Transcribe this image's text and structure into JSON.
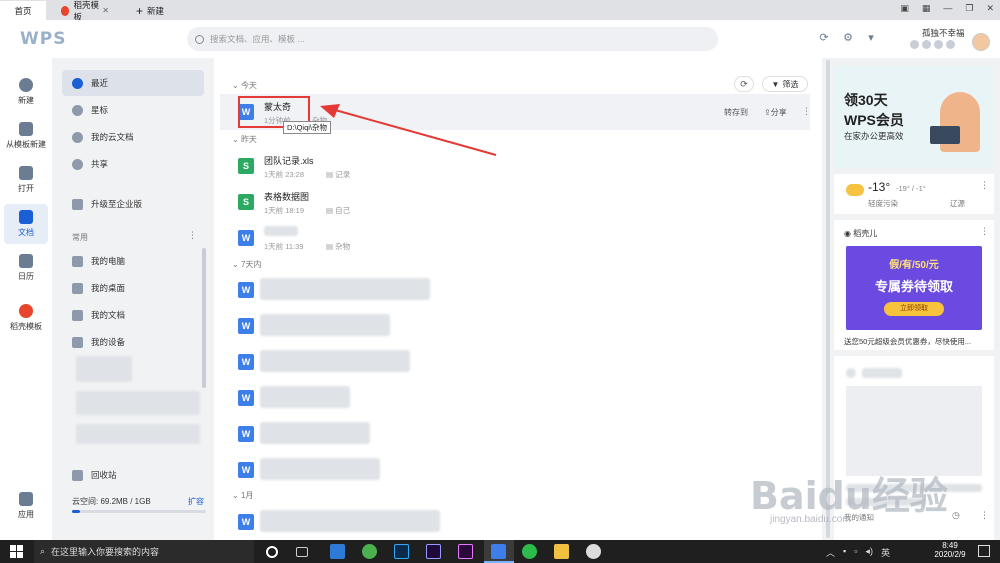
{
  "tabs": {
    "home": "首页",
    "template": "稻壳模板",
    "new": "新建"
  },
  "search": {
    "placeholder": "搜索文档、应用、模板 ..."
  },
  "user": {
    "name": "孤独不幸福"
  },
  "rail": {
    "new": "新建",
    "from_template": "从模板新建",
    "open": "打开",
    "docs": "文档",
    "calendar": "日历",
    "daoke": "稻壳模板",
    "apps": "应用"
  },
  "nav": {
    "recent": "最近",
    "star": "星标",
    "cloud": "我的云文档",
    "share": "共享",
    "upgrade": "升级至企业版",
    "frequent": "常用",
    "computer": "我的电脑",
    "desktop": "我的桌面",
    "documents": "我的文档",
    "devices": "我的设备",
    "recycle": "回收站",
    "cloud_space": "云空间: 69.2MB / 1GB",
    "expand": "扩容"
  },
  "main": {
    "filter": "筛选",
    "sections": {
      "today": "今天",
      "yesterday": "昨天",
      "week": "7天内",
      "jan": "1月"
    },
    "files": [
      {
        "name": "蒙太奇",
        "time": "1分钟前",
        "loc": "杂物",
        "actions_move": "转存到",
        "actions_share": "分享"
      },
      {
        "name": "团队记录.xls",
        "time": "1天前 23:28",
        "loc": "记录"
      },
      {
        "name": "表格数据图",
        "time": "1天前 18:19",
        "loc": "自己"
      },
      {
        "name": "",
        "time": "1天前 11:39",
        "loc": "杂物"
      }
    ],
    "tooltip": "D:\\Qiqi\\杂物"
  },
  "right": {
    "ad_title1": "领30天",
    "ad_title2": "WPS会员",
    "ad_sub": "在家办公更高效",
    "weather_temp": "-13°",
    "weather_range": "-19° / -1°",
    "weather_aq": "轻度污染",
    "weather_city": "辽源",
    "daoke_title": "稻壳儿",
    "coupon": "假/有/50/元",
    "coupon_title": "专属券待领取",
    "coupon_btn": "立即领取",
    "coupon_desc": "送您50元超级会员优惠券，尽快使用...",
    "notice": "我的通知"
  },
  "taskbar": {
    "search": "在这里输入你要搜索的内容",
    "time": "8:49",
    "date": "2020/2/9",
    "ime": "英"
  },
  "watermark": {
    "brand": "Baidu经验",
    "url": "jingyan.baidu.com"
  }
}
